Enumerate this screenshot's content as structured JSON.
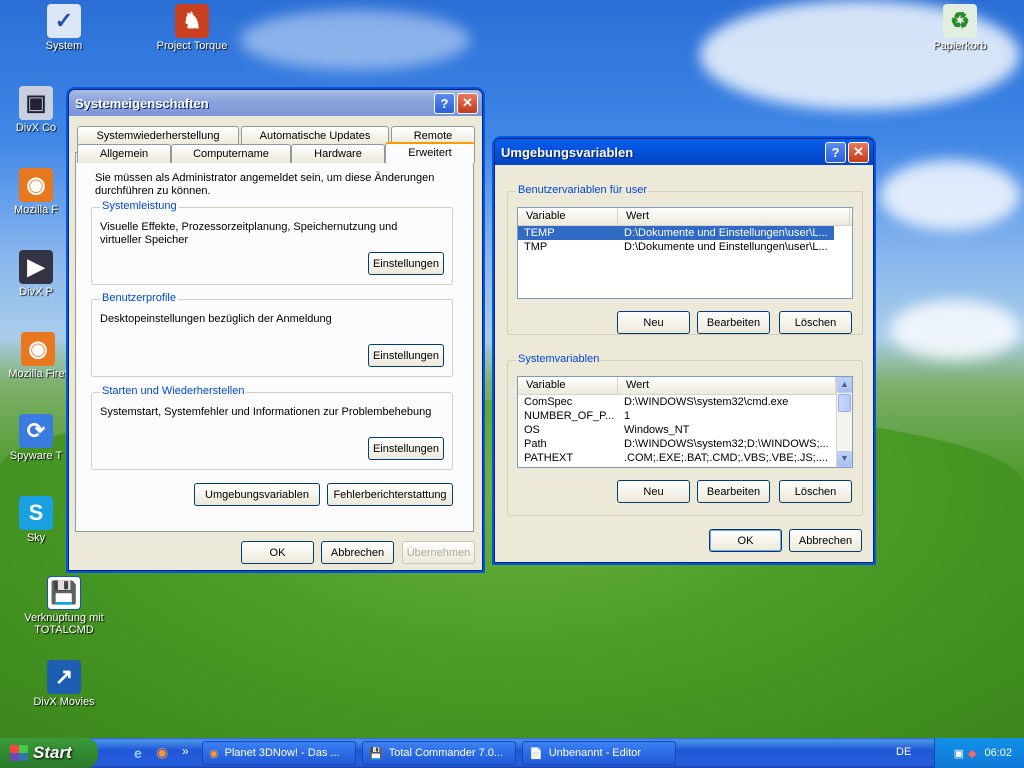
{
  "desktop": {
    "icons": [
      {
        "label": "System",
        "icon": "system-icon"
      },
      {
        "label": "Project Torque",
        "icon": "game-icon"
      },
      {
        "label": "DivX Co",
        "icon": "divx-icon"
      },
      {
        "label": "Mozilla F",
        "icon": "firefox-icon"
      },
      {
        "label": "DivX P",
        "icon": "divx-player-icon"
      },
      {
        "label": "Mozilla Firef",
        "icon": "firefox-icon"
      },
      {
        "label": "Spyware T",
        "icon": "spyware-icon"
      },
      {
        "label": "Sky",
        "icon": "skype-icon"
      },
      {
        "label": "Verknüpfung mit TOTALCMD",
        "icon": "totalcmd-icon"
      },
      {
        "label": "DivX Movies",
        "icon": "divx-movies-icon"
      },
      {
        "label": "Papierkorb",
        "icon": "recycle-bin-icon"
      }
    ]
  },
  "sysprops": {
    "title": "Systemeigenschaften",
    "tabs_row1": [
      "Systemwiederherstellung",
      "Automatische Updates",
      "Remote"
    ],
    "tabs_row2": [
      "Allgemein",
      "Computername",
      "Hardware",
      "Erweitert"
    ],
    "admin_note": "Sie müssen als Administrator angemeldet sein, um diese Änderungen durchführen zu können.",
    "groups": [
      {
        "legend": "Systemleistung",
        "text": "Visuelle Effekte, Prozessorzeitplanung, Speichernutzung und virtueller Speicher",
        "button": "Einstellungen"
      },
      {
        "legend": "Benutzerprofile",
        "text": "Desktopeinstellungen bezüglich der Anmeldung",
        "button": "Einstellungen"
      },
      {
        "legend": "Starten und Wiederherstellen",
        "text": "Systemstart, Systemfehler und Informationen zur Problembehebung",
        "button": "Einstellungen"
      }
    ],
    "env_button": "Umgebungsvariablen",
    "error_button": "Fehlerberichterstattung",
    "ok": "OK",
    "cancel": "Abbrechen",
    "apply": "Übernehmen"
  },
  "envvars": {
    "title": "Umgebungsvariablen",
    "user_group": "Benutzervariablen für user",
    "columns": [
      "Variable",
      "Wert"
    ],
    "user_vars": [
      {
        "name": "TEMP",
        "value": "D:\\Dokumente und Einstellungen\\user\\L..."
      },
      {
        "name": "TMP",
        "value": "D:\\Dokumente und Einstellungen\\user\\L..."
      }
    ],
    "system_group": "Systemvariablen",
    "system_vars": [
      {
        "name": "ComSpec",
        "value": "D:\\WINDOWS\\system32\\cmd.exe"
      },
      {
        "name": "NUMBER_OF_P...",
        "value": "1"
      },
      {
        "name": "OS",
        "value": "Windows_NT"
      },
      {
        "name": "Path",
        "value": "D:\\WINDOWS\\system32;D:\\WINDOWS;..."
      },
      {
        "name": "PATHEXT",
        "value": ".COM;.EXE;.BAT;.CMD;.VBS;.VBE;.JS;...."
      }
    ],
    "new": "Neu",
    "edit": "Bearbeiten",
    "delete": "Löschen",
    "ok": "OK",
    "cancel": "Abbrechen"
  },
  "taskbar": {
    "start": "Start",
    "items": [
      "Planet 3DNow! - Das ...",
      "Total Commander 7.0...",
      "Unbenannt - Editor"
    ],
    "lang": "DE",
    "clock": "06:02"
  }
}
